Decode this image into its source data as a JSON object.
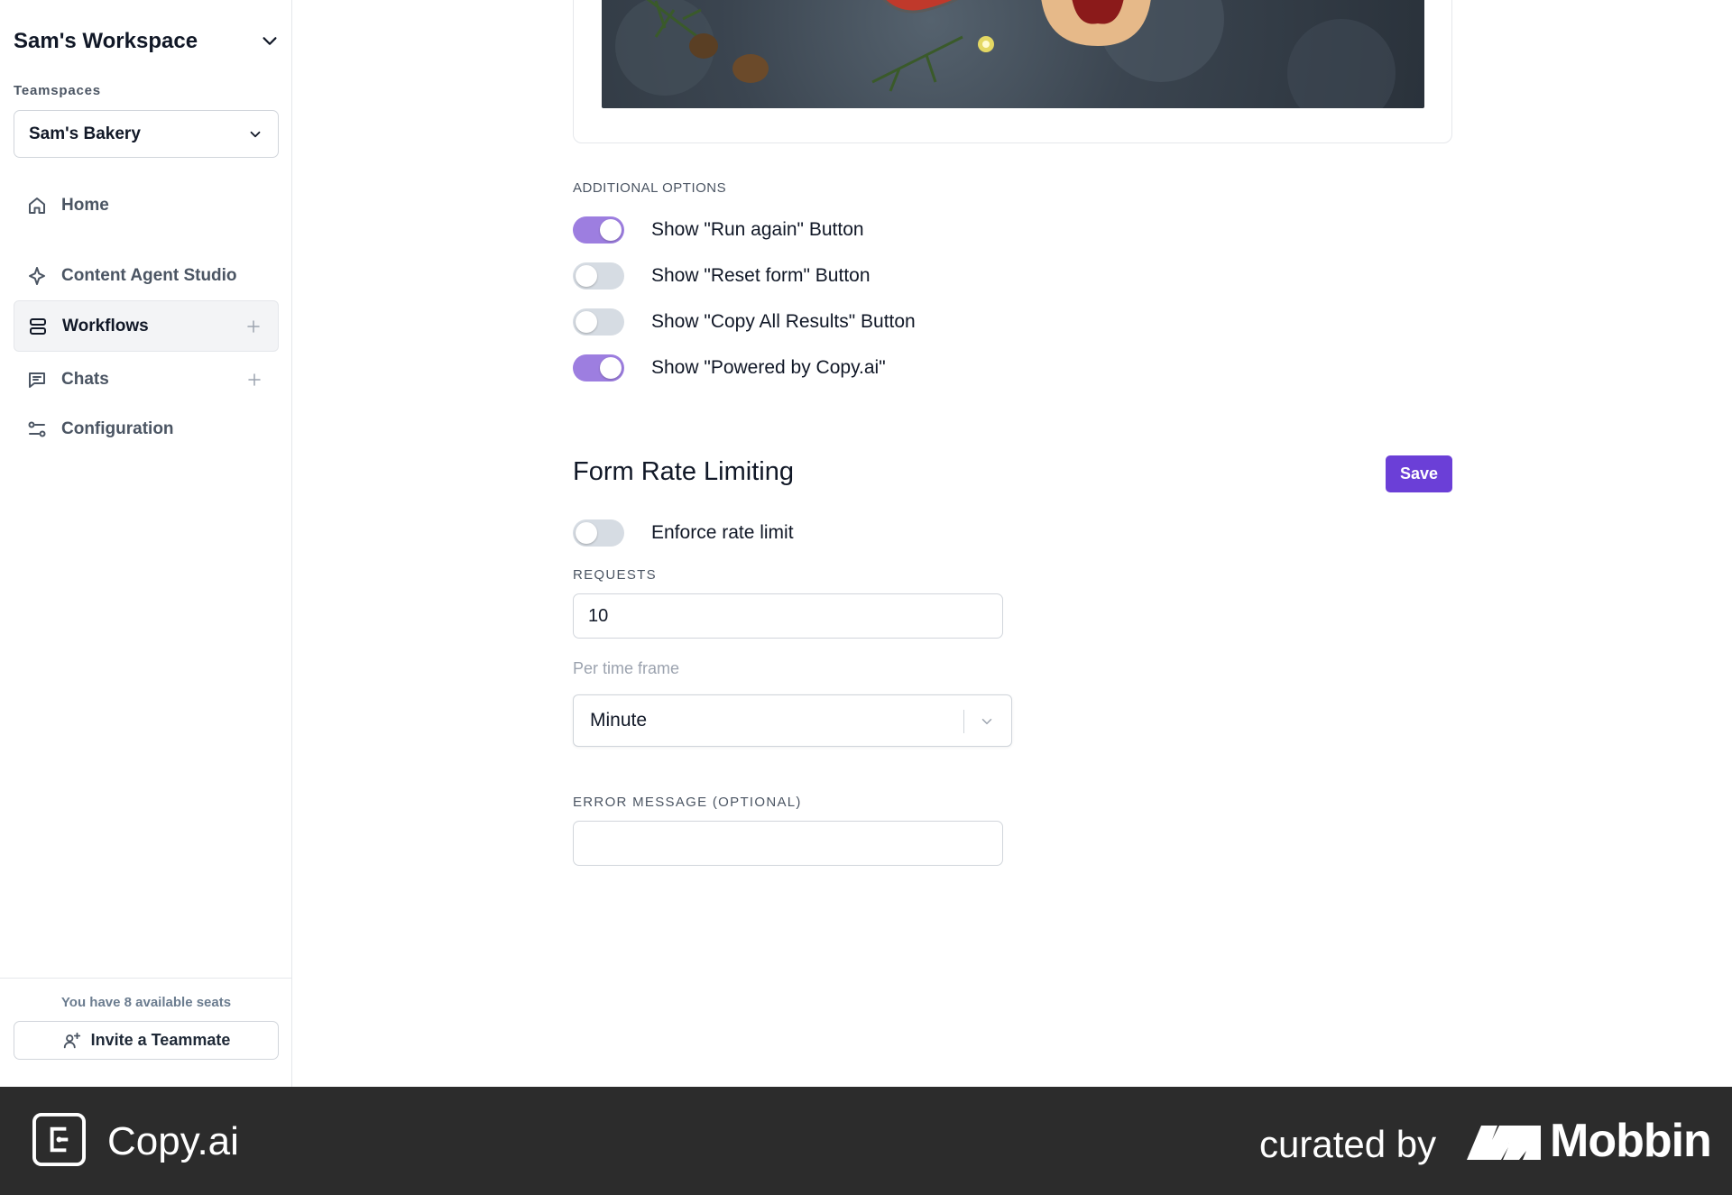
{
  "sidebar": {
    "workspace_title": "Sam's Workspace",
    "teamspaces_label": "Teamspaces",
    "teamspace_selected": "Sam's Bakery",
    "nav": [
      {
        "label": "Home",
        "icon": "home-icon"
      },
      {
        "label": "Content Agent Studio",
        "icon": "sparkle-icon"
      },
      {
        "label": "Workflows",
        "icon": "workflow-icon",
        "active": true
      },
      {
        "label": "Chats",
        "icon": "chat-icon"
      },
      {
        "label": "Configuration",
        "icon": "sliders-icon"
      }
    ],
    "seats_text": "You have 8 available seats",
    "invite_label": "Invite a Teammate"
  },
  "main": {
    "additional_options_label": "ADDITIONAL OPTIONS",
    "options": [
      {
        "label": "Show \"Run again\" Button",
        "enabled": true
      },
      {
        "label": "Show \"Reset form\" Button",
        "enabled": false
      },
      {
        "label": "Show \"Copy All Results\" Button",
        "enabled": false
      },
      {
        "label": "Show \"Powered by Copy.ai\"",
        "enabled": true
      }
    ],
    "rate_limit": {
      "title": "Form Rate Limiting",
      "save_label": "Save",
      "enforce_label": "Enforce rate limit",
      "enforce_enabled": false,
      "requests_label": "REQUESTS",
      "requests_value": "10",
      "timeframe_label": "Per time frame",
      "timeframe_value": "Minute",
      "error_label": "ERROR MESSAGE (OPTIONAL)",
      "error_value": ""
    }
  },
  "footer": {
    "brand": "Copy.ai",
    "curated_by": "curated by",
    "curator": "Mobbin"
  },
  "colors": {
    "accent": "#6b3fd7",
    "toggle_on": "#9d7ee0",
    "toggle_off": "#d6dce3",
    "footer_bg": "#2c2c2c"
  }
}
